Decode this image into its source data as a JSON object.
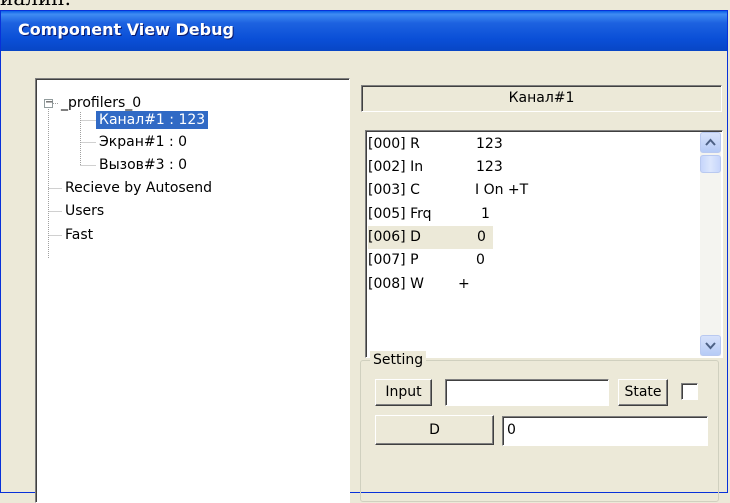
{
  "cropped_text": "иалин.",
  "window": {
    "title": "Component View Debug"
  },
  "tree": {
    "expander_glyph": "−",
    "root": "_profilers_0",
    "children": [
      "Канал#1 : 123",
      "Экран#1 : 0",
      "Вызов#3 : 0"
    ],
    "siblings": [
      "Recieve by Autosend",
      "Users",
      "Fast"
    ],
    "selected_index": 0
  },
  "channel_header": "Канал#1",
  "list": {
    "rows": [
      {
        "code": "[000] R",
        "value": "123"
      },
      {
        "code": "[002] In",
        "value": "123"
      },
      {
        "code": "[003] C",
        "value": "I On +T"
      },
      {
        "code": "[005] Frq",
        "value": "1"
      },
      {
        "code": "[006] D",
        "value": "0"
      },
      {
        "code": "[007] P",
        "value": "0"
      },
      {
        "code": "[008] W",
        "value": "+"
      }
    ],
    "highlighted_index": 4,
    "scroll_up_icon": "chevron-up-icon",
    "scroll_down_icon": "chevron-down-icon"
  },
  "settings": {
    "legend": "Setting",
    "input_button": "Input",
    "input_value": "",
    "state_button": "State",
    "state_checked": false,
    "d_button": "D",
    "d_value": "0"
  },
  "colors": {
    "titlebar": "#0a4fd7",
    "selection": "#316ac5",
    "face": "#ece9d8"
  }
}
